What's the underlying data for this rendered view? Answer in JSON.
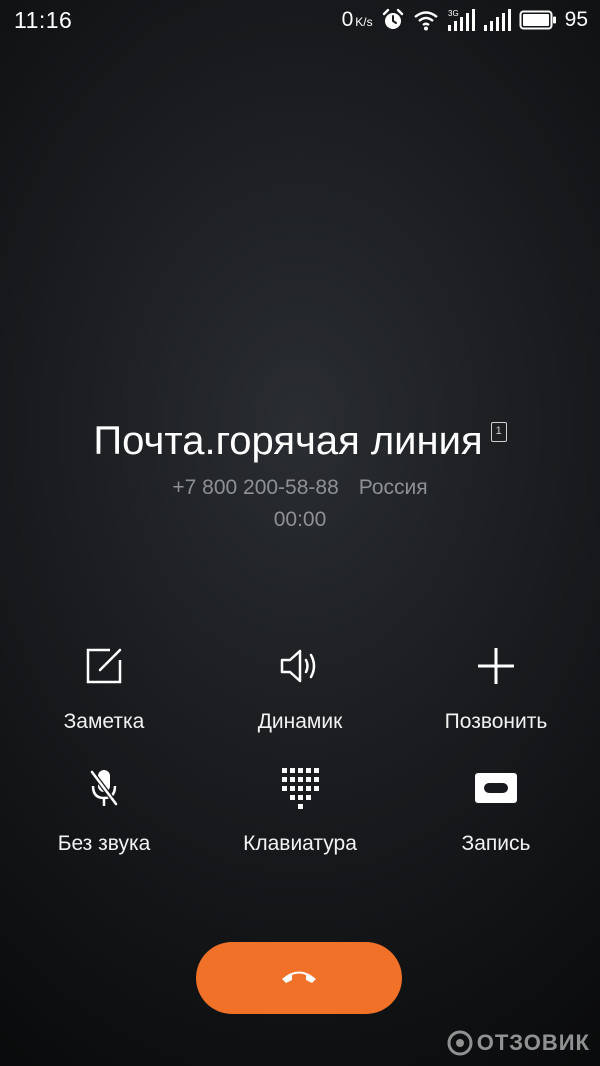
{
  "status_bar": {
    "time": "11:16",
    "net_speed_value": "0",
    "net_speed_unit": "K/s",
    "network_type": "3G",
    "battery": "95",
    "icons": [
      "alarm-icon",
      "wifi-icon",
      "signal-3g-icon",
      "signal-icon",
      "battery-icon"
    ]
  },
  "caller": {
    "name": "Почта.горячая линия",
    "sim_slot": "1",
    "number": "+7 800 200-58-88",
    "region": "Россия",
    "duration": "00:00"
  },
  "actions": [
    {
      "label": "Заметка",
      "icon": "note-icon"
    },
    {
      "label": "Динамик",
      "icon": "speaker-icon"
    },
    {
      "label": "Позвонить",
      "icon": "add-call-icon"
    },
    {
      "label": "Без звука",
      "icon": "mute-icon"
    },
    {
      "label": "Клавиатура",
      "icon": "keypad-icon"
    },
    {
      "label": "Запись",
      "icon": "record-icon"
    }
  ],
  "end_call": {
    "icon": "end-call-icon",
    "color": "#f07127"
  },
  "watermark": {
    "text": "ОТЗОВИК"
  }
}
